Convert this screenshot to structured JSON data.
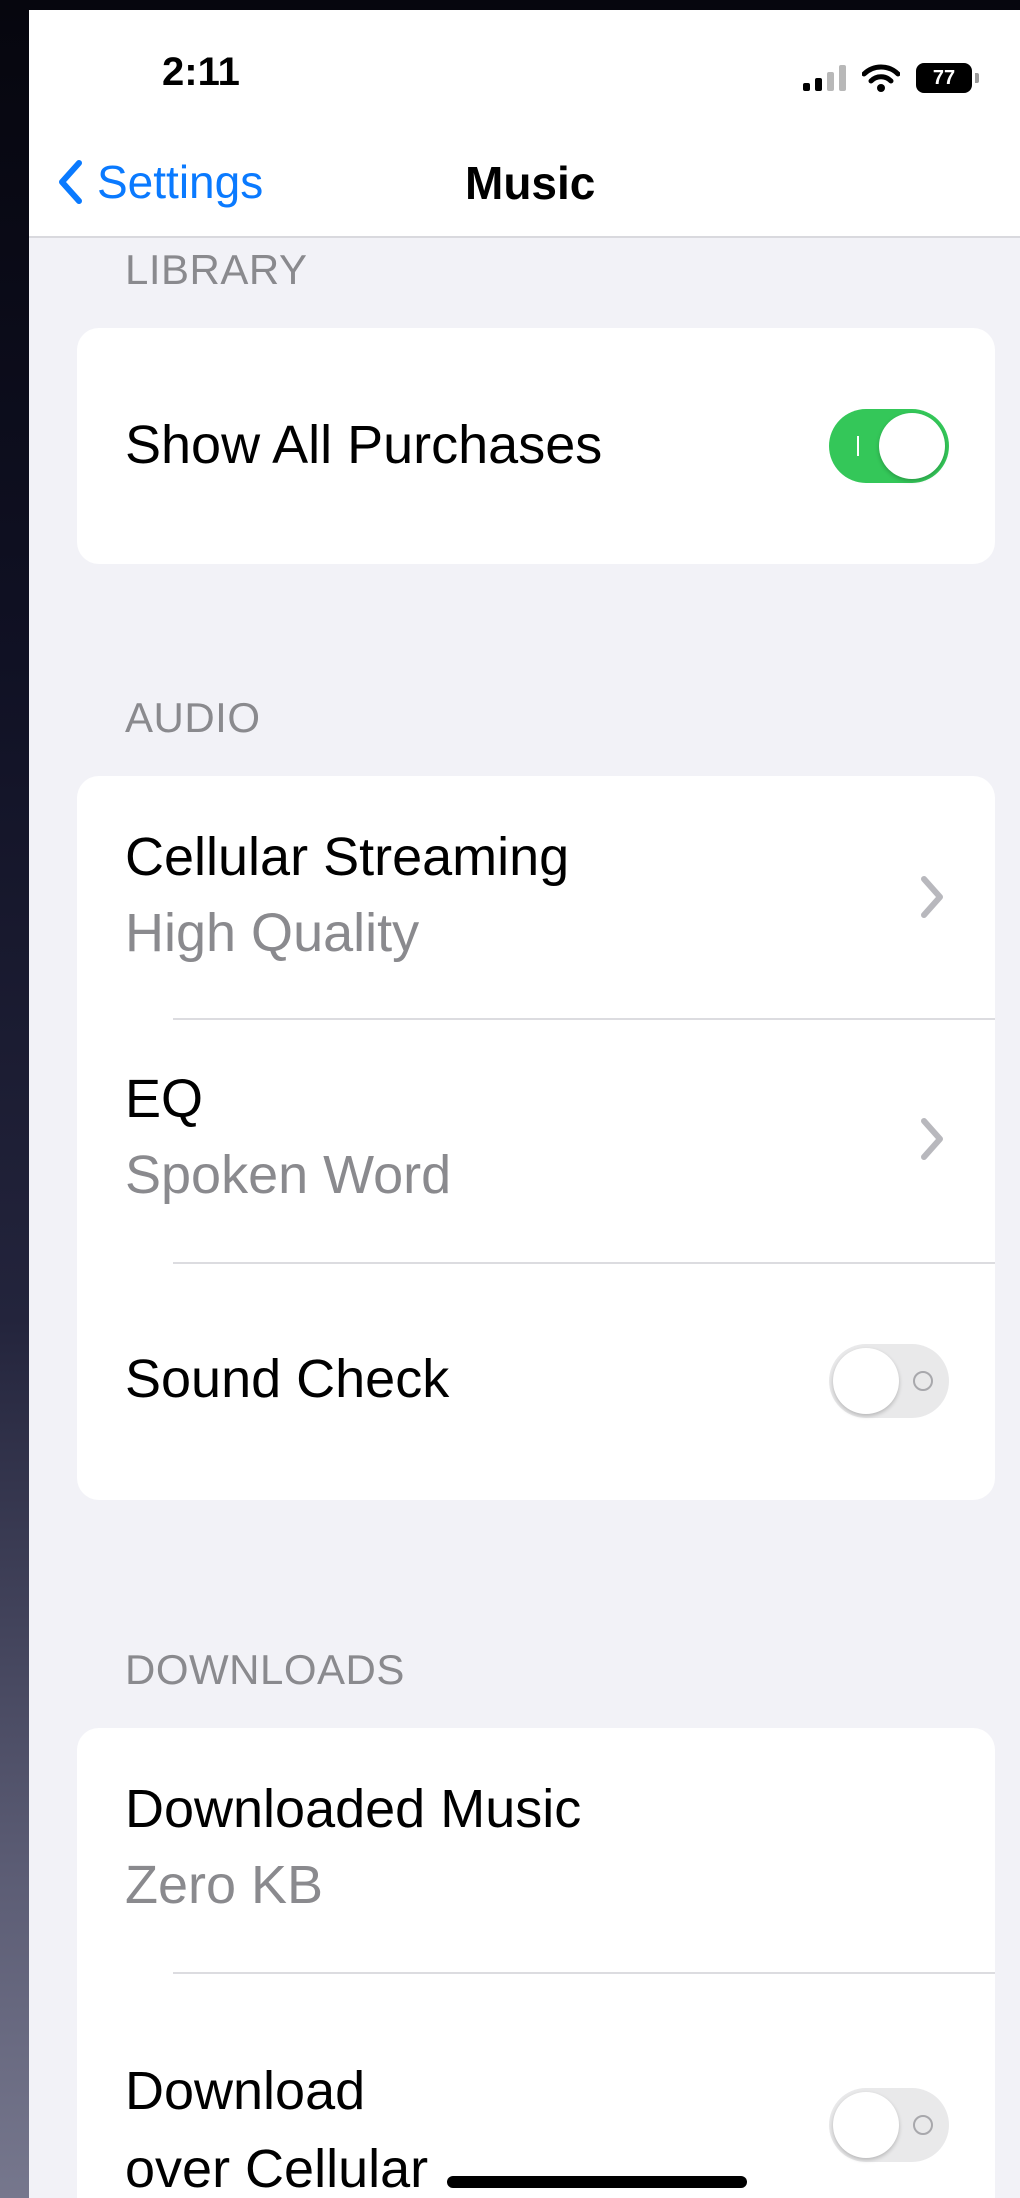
{
  "status_bar": {
    "time": "2:11",
    "battery": "77"
  },
  "nav": {
    "back_label": "Settings",
    "title": "Music"
  },
  "sections": {
    "library": {
      "header": "LIBRARY",
      "show_all_purchases": {
        "label": "Show All Purchases",
        "enabled": true
      }
    },
    "audio": {
      "header": "AUDIO",
      "cellular_streaming": {
        "label": "Cellular Streaming",
        "value": "High Quality"
      },
      "eq": {
        "label": "EQ",
        "value": "Spoken Word"
      },
      "sound_check": {
        "label": "Sound Check",
        "enabled": false
      }
    },
    "downloads": {
      "header": "DOWNLOADS",
      "downloaded_music": {
        "label": "Downloaded Music",
        "value": "Zero KB"
      },
      "download_over_cellular": {
        "label_line1": "Download",
        "label_line2": "over Cellular",
        "enabled": false
      }
    }
  },
  "colors": {
    "accent": "#0a7aff",
    "toggle_on": "#34c759",
    "toggle_off": "#e9e9ea",
    "secondary_text": "#8a8a8e",
    "background": "#f2f2f7"
  }
}
